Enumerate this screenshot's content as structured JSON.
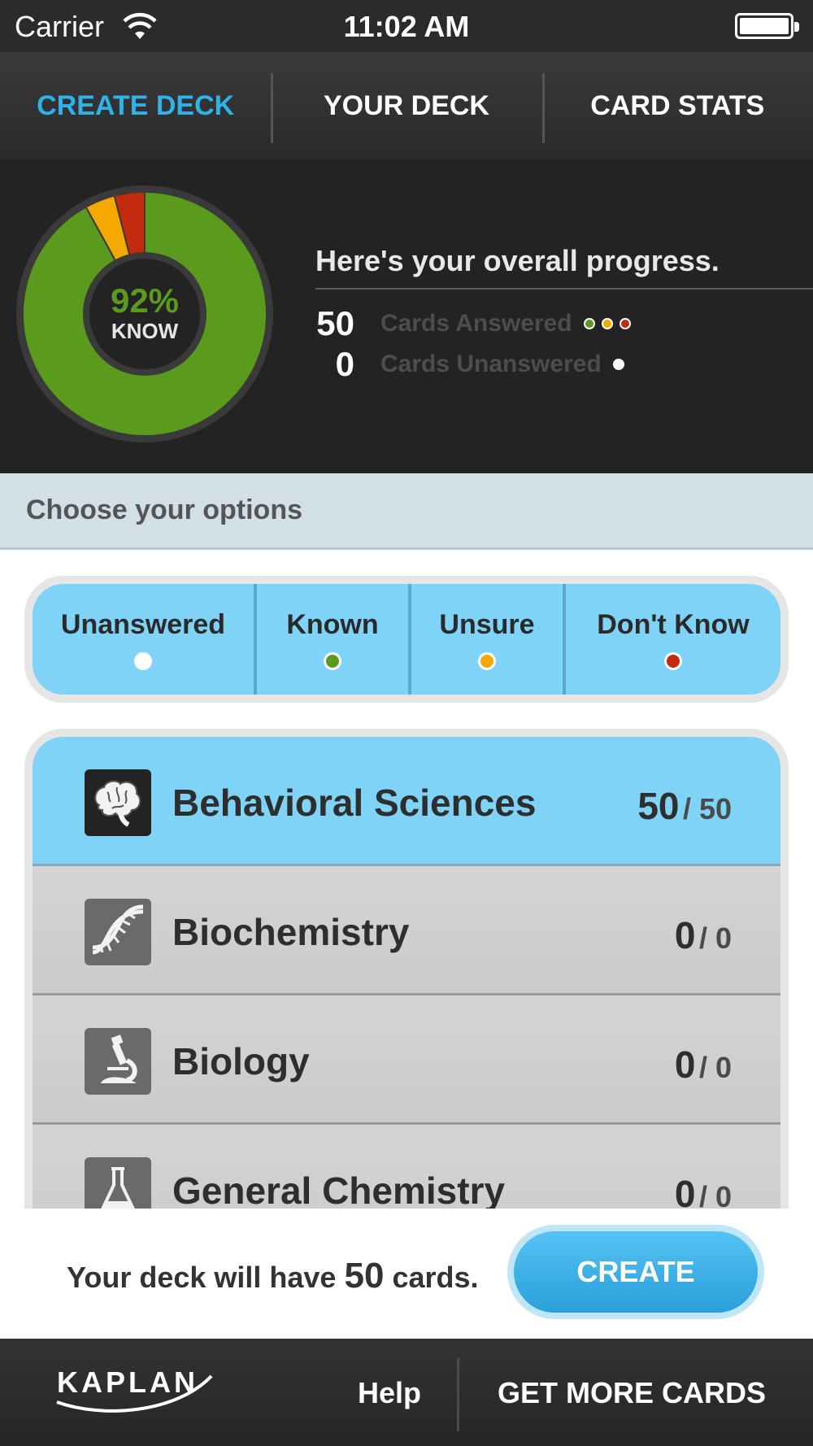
{
  "status_bar": {
    "carrier": "Carrier",
    "time": "11:02 AM"
  },
  "tabs": [
    {
      "label": "CREATE DECK",
      "active": true
    },
    {
      "label": "YOUR DECK",
      "active": false
    },
    {
      "label": "CARD STATS",
      "active": false
    }
  ],
  "progress": {
    "headline": "Here's your overall progress.",
    "percent_label": "92%",
    "know_label": "KNOW",
    "answered_count": "50",
    "answered_label": "Cards Answered",
    "unanswered_count": "0",
    "unanswered_label": "Cards Unanswered",
    "breakdown": {
      "known": 0.92,
      "unsure": 0.04,
      "dont_know": 0.04
    }
  },
  "colors": {
    "accent": "#2fb1ea",
    "known": "#5a9a1c",
    "unsure": "#f5a800",
    "dont_know": "#c42b0c",
    "unanswered": "#ffffff",
    "selected_row": "#7fd3f7"
  },
  "options": {
    "title": "Choose your options",
    "filters": [
      {
        "label": "Unanswered",
        "dot": "#ffffff"
      },
      {
        "label": "Known",
        "dot": "#5a9a1c"
      },
      {
        "label": "Unsure",
        "dot": "#f5a800"
      },
      {
        "label": "Don't Know",
        "dot": "#c42b0c"
      }
    ]
  },
  "categories": [
    {
      "name": "Behavioral Sciences",
      "selected_count": "50",
      "total": "/ 50",
      "icon": "brain-icon",
      "selected": true
    },
    {
      "name": "Biochemistry",
      "selected_count": "0",
      "total": "/ 0",
      "icon": "dna-icon",
      "selected": false
    },
    {
      "name": "Biology",
      "selected_count": "0",
      "total": "/ 0",
      "icon": "microscope-icon",
      "selected": false
    },
    {
      "name": "General Chemistry",
      "selected_count": "0",
      "total": "/ 0",
      "icon": "flask-icon",
      "selected": false
    }
  ],
  "create": {
    "prefix": "Your deck will have",
    "count": "50",
    "suffix": "cards.",
    "button_label": "CREATE"
  },
  "footer": {
    "logo_text": "KAPLAN",
    "help_label": "Help",
    "more_label": "GET MORE CARDS"
  }
}
